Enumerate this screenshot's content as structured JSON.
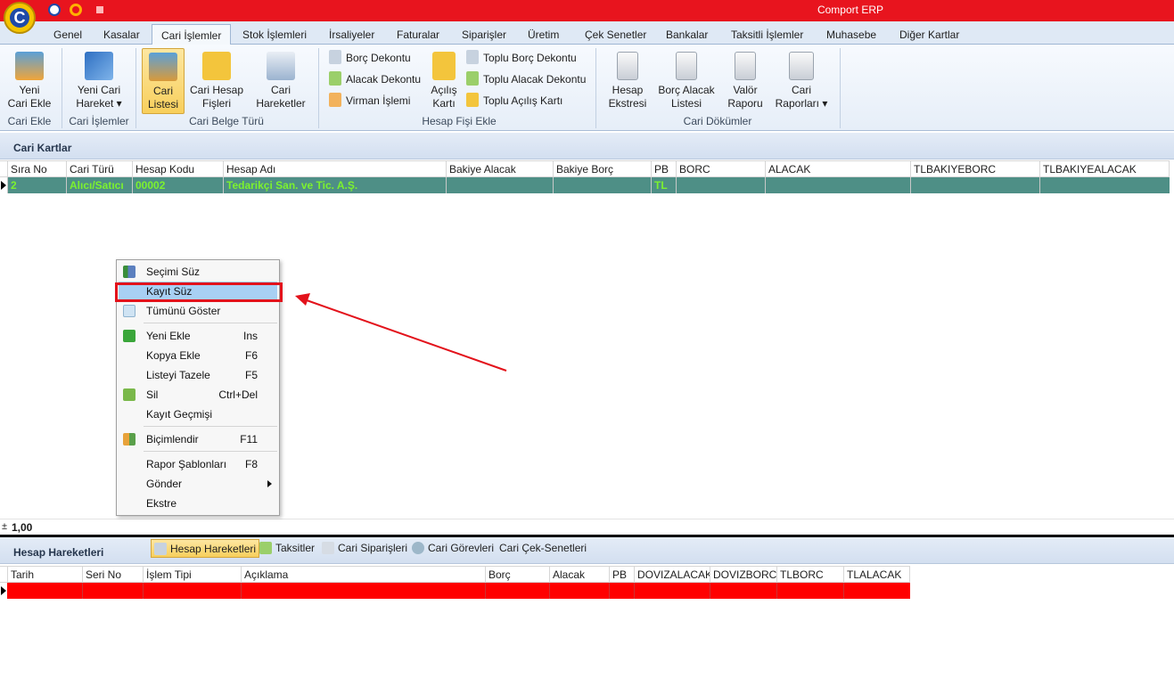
{
  "window": {
    "title": "Comport ERP",
    "logo_letter": "C"
  },
  "tabs": [
    {
      "label": "Genel"
    },
    {
      "label": "Kasalar"
    },
    {
      "label": "Cari İşlemler"
    },
    {
      "label": "Stok İşlemleri"
    },
    {
      "label": "İrsaliyeler"
    },
    {
      "label": "Faturalar"
    },
    {
      "label": "Siparişler"
    },
    {
      "label": "Üretim"
    },
    {
      "label": "Çek Senetler"
    },
    {
      "label": "Bankalar"
    },
    {
      "label": "Taksitli İşlemler"
    },
    {
      "label": "Muhasebe"
    },
    {
      "label": "Diğer Kartlar"
    }
  ],
  "active_tab": "Cari İşlemler",
  "ribbon": {
    "yeni_cari_ekle": "Yeni\nCari Ekle",
    "group_cari_ekle": "Cari Ekle",
    "yeni_cari_hareket": "Yeni Cari\nHareket ▾",
    "group_cari_islemler": "Cari İşlemler",
    "cari_listesi": "Cari\nListesi",
    "cari_hesap_fisleri": "Cari Hesap\nFişleri",
    "cari_hareketler": "Cari\nHareketler",
    "group_cari_belge_turu": "Cari Belge Türü",
    "borc_dekontu": "Borç Dekontu",
    "alacak_dekontu": "Alacak Dekontu",
    "virman_islemi": "Virman İşlemi",
    "acilis_karti": "Açılış\nKartı",
    "toplu_borc_dekontu": "Toplu Borç Dekontu",
    "toplu_alacak_dekontu": "Toplu Alacak Dekontu",
    "toplu_acilis_karti": "Toplu Açılış Kartı",
    "group_hesap_fisi_ekle": "Hesap Fişi Ekle",
    "hesap_ekstresi": "Hesap\nEkstresi",
    "borc_alacak_listesi": "Borç Alacak\nListesi",
    "valor_raporu": "Valör\nRaporu",
    "cari_raporlari": "Cari\nRaporları ▾",
    "group_cari_dokumler": "Cari Dökümler"
  },
  "cari_kartlar": {
    "title": "Cari Kartlar",
    "columns": [
      "Sıra No",
      "Cari Türü",
      "Hesap Kodu",
      "Hesap Adı",
      "Bakiye Alacak",
      "Bakiye Borç",
      "PB",
      "BORC",
      "ALACAK",
      "TLBAKIYEBORC",
      "TLBAKIYEALACAK"
    ],
    "rows": [
      {
        "sira_no": "2",
        "cari_turu": "Alıcı/Satıcı",
        "hesap_kodu": "00002",
        "hesap_adi": "Tedarikçi San. ve Tic. A.Ş.",
        "bakiye_alacak": "",
        "bakiye_borc": "",
        "pb": "TL",
        "borc": "",
        "alacak": "",
        "tlbakiyeborc": "",
        "tlbakiyealacak": ""
      }
    ],
    "footer_total": "1,00"
  },
  "context_menu": {
    "items": [
      {
        "label": "Seçimi Süz",
        "shortcut": ""
      },
      {
        "label": "Kayıt Süz",
        "shortcut": ""
      },
      {
        "label": "Tümünü Göster",
        "shortcut": ""
      },
      {
        "label": "Yeni Ekle",
        "shortcut": "Ins"
      },
      {
        "label": "Kopya Ekle",
        "shortcut": "F6"
      },
      {
        "label": "Listeyi Tazele",
        "shortcut": "F5"
      },
      {
        "label": "Sil",
        "shortcut": "Ctrl+Del"
      },
      {
        "label": "Kayıt Geçmişi",
        "shortcut": ""
      },
      {
        "label": "Biçimlendir",
        "shortcut": "F11"
      },
      {
        "label": "Rapor Şablonları",
        "shortcut": "F8"
      },
      {
        "label": "Gönder",
        "shortcut": ""
      },
      {
        "label": "Ekstre",
        "shortcut": ""
      }
    ],
    "highlighted": "Kayıt Süz"
  },
  "hesap_hareketleri": {
    "title": "Hesap Hareketleri",
    "sub_tabs": [
      {
        "label": "Hesap Hareketleri"
      },
      {
        "label": "Taksitler"
      },
      {
        "label": "Cari Siparişleri"
      },
      {
        "label": "Cari Görevleri"
      },
      {
        "label": "Cari Çek-Senetleri"
      }
    ],
    "columns": [
      "Tarih",
      "Seri No",
      "İşlem Tipi",
      "Açıklama",
      "Borç",
      "Alacak",
      "PB",
      "DOVIZALACAK",
      "DOVIZBORC",
      "TLBORC",
      "TLALACAK"
    ]
  },
  "colors": {
    "titlebar": "#e8141e",
    "selected_row": "#4e8f86",
    "selected_row_text": "#7cf22e",
    "error_row": "#ff0000",
    "annotation": "#e3121b"
  }
}
